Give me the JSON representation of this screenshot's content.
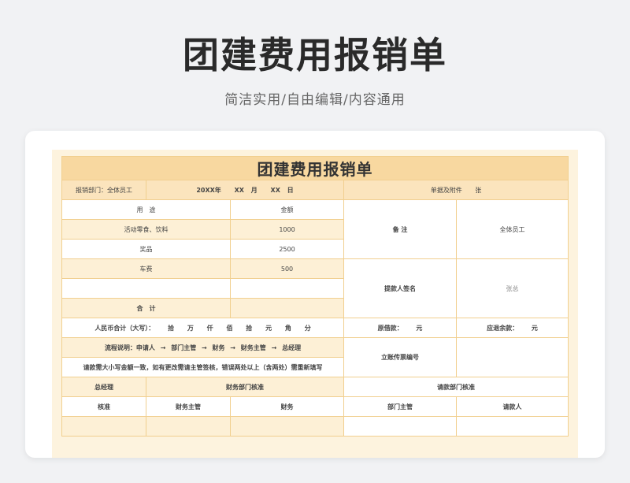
{
  "page": {
    "title": "团建费用报销单",
    "subtitle": "简洁实用/自由编辑/内容通用"
  },
  "form": {
    "title": "团建费用报销单",
    "dept_label": "报销部门：全体员工",
    "date": {
      "year": "20XX年",
      "month": "XX",
      "month_unit": "月",
      "day": "XX",
      "day_unit": "日"
    },
    "attachments": {
      "label": "单据及附件",
      "unit": "张"
    },
    "col_use": "用　途",
    "col_amount": "金额",
    "items": [
      {
        "use": "活动零食、饮料",
        "amount": "1000"
      },
      {
        "use": "奖品",
        "amount": "2500"
      },
      {
        "use": "车费",
        "amount": "500"
      },
      {
        "use": "",
        "amount": ""
      }
    ],
    "total_label": "合　计",
    "remark_label": "备 注",
    "remark_value": "全体员工",
    "payee_label": "提款人签名",
    "payee_value": "张总",
    "rmb_label": "人民币合计（大写）：",
    "rmb_units": [
      "拾",
      "万",
      "仟",
      "佰",
      "拾",
      "元",
      "角",
      "分"
    ],
    "borrowed": {
      "label": "原借款：",
      "unit": "元"
    },
    "refund": {
      "label": "应退余款：",
      "unit": "元"
    },
    "flow": {
      "label": "流程说明：申请人",
      "steps": [
        "部门主管",
        "财务",
        "财务主管",
        "总经理"
      ],
      "arrow": "→"
    },
    "invoice_label": "立账传票编号",
    "note": "请款需大小写金额一致，如有更改需请主管签核，错误两处以上（含两处）需重新填写",
    "approvals": {
      "gm": "总经理",
      "finance_dept": "财务部门核准",
      "request_dept": "请款部门核准",
      "approve": "核准",
      "finance_manager": "财务主管",
      "finance": "财务",
      "dept_manager": "部门主管",
      "requester": "请款人"
    }
  }
}
